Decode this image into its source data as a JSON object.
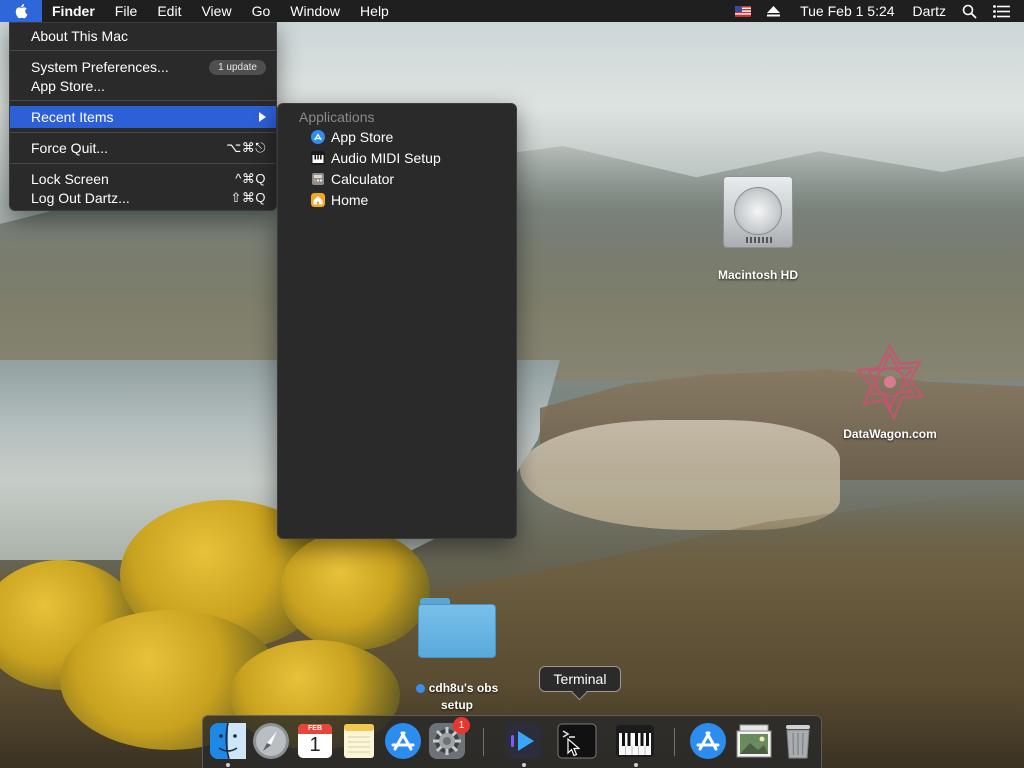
{
  "menubar": {
    "items": [
      "Finder",
      "File",
      "Edit",
      "View",
      "Go",
      "Window",
      "Help"
    ],
    "datetime": "Tue Feb 1  5:24",
    "user": "Dartz",
    "status_icons": [
      "us-flag-icon",
      "eject-icon",
      "search-icon",
      "list-icon"
    ]
  },
  "apple_menu": {
    "about": "About This Mac",
    "system_preferences": "System Preferences...",
    "update_badge": "1 update",
    "app_store": "App Store...",
    "recent_items": "Recent Items",
    "force_quit": "Force Quit...",
    "force_quit_shortcut": "⌥⌘⎋",
    "lock_screen": "Lock Screen",
    "lock_screen_shortcut": "^⌘Q",
    "log_out": "Log Out Dartz...",
    "log_out_shortcut": "⇧⌘Q"
  },
  "recent_items": {
    "header": "Applications",
    "apps": [
      "App Store",
      "Audio MIDI Setup",
      "Calculator",
      "Home"
    ]
  },
  "desktop": {
    "macintosh_hd": "Macintosh HD",
    "datawagon": "DataWagon.com",
    "folder_line1": "cdh8u's obs",
    "folder_line2": "setup"
  },
  "tooltip": "Terminal",
  "dock": {
    "calendar_month": "FEB",
    "calendar_day": "1",
    "settings_badge": "1",
    "apps": [
      "Finder",
      "Launchpad",
      "Calendar",
      "Notes",
      "App Store",
      "System Preferences",
      "Codeshot",
      "Terminal",
      "Piano",
      "App Store",
      "Preview",
      "Trash"
    ]
  },
  "colors": {
    "menu_highlight": "#2d5fd6",
    "menubar": "#1f1f1f",
    "menu_bg": "#2a2a2a"
  }
}
